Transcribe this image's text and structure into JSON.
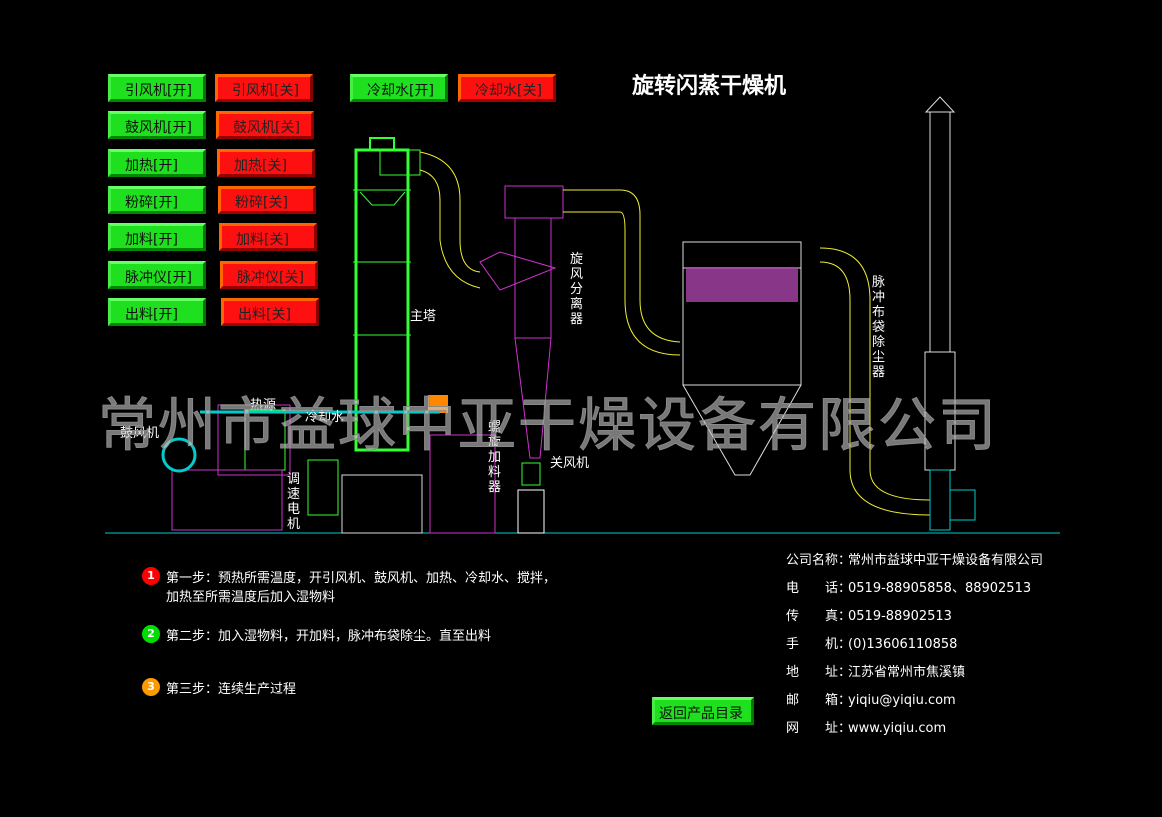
{
  "title": "旋转闪蒸干燥机",
  "controls": [
    {
      "on": "引风机[开]",
      "off": "引风机[关]"
    },
    {
      "on": "鼓风机[开]",
      "off": "鼓风机[关]"
    },
    {
      "on": "加热[开]",
      "off": "加热[关]"
    },
    {
      "on": "粉碎[开]",
      "off": "粉碎[关]"
    },
    {
      "on": "加料[开]",
      "off": "加料[关]"
    },
    {
      "on": "脉冲仪[开]",
      "off": "脉冲仪[关]"
    },
    {
      "on": "出料[开]",
      "off": "出料[关]"
    }
  ],
  "cooling": {
    "on": "冷却水[开]",
    "off": "冷却水[关]"
  },
  "diagram_labels": {
    "tower": "主塔",
    "cyclone": "旋风分离器",
    "bag_filter": "脉冲布袋除尘器",
    "heat": "热源",
    "cooling": "冷却水",
    "blower": "鼓风机",
    "motor": "调速电机",
    "feeder": "螺旋加料器",
    "valve": "关风机"
  },
  "watermark": "常州市益球中亚干燥设备有限公司",
  "steps": [
    {
      "num": "1",
      "color": "#ff0000",
      "text": "第一步：预热所需温度，开引风机、鼓风机、加热、冷却水、搅拌，",
      "text2": "加热至所需温度后加入湿物料"
    },
    {
      "num": "2",
      "color": "#00dd00",
      "text": "第二步：加入湿物料，开加料，脉冲布袋除尘。直至出料"
    },
    {
      "num": "3",
      "color": "#ff9900",
      "text": "第三步：连续生产过程"
    }
  ],
  "back_button": "返回产品目录",
  "contact": [
    {
      "k": "公司名称：",
      "v": "常州市益球中亚干燥设备有限公司"
    },
    {
      "k": "电　　话：",
      "v": "0519-88905858、88902513"
    },
    {
      "k": "传　　真：",
      "v": "0519-88902513"
    },
    {
      "k": "手　　机：",
      "v": "(0)13606110858"
    },
    {
      "k": "地　　址：",
      "v": "江苏省常州市焦溪镇"
    },
    {
      "k": "邮　　箱：",
      "v": "yiqiu@yiqiu.com"
    },
    {
      "k": "网　　址：",
      "v": "www.yiqiu.com"
    }
  ]
}
